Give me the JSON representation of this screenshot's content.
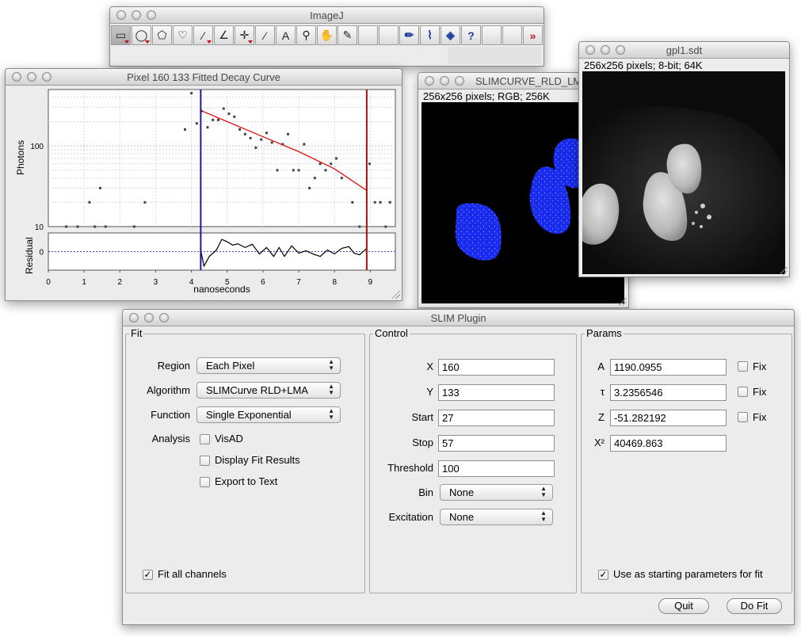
{
  "imagej": {
    "title": "ImageJ",
    "tools": [
      {
        "name": "rectangle-tool-icon",
        "glyph": "▭"
      },
      {
        "name": "oval-tool-icon",
        "glyph": "◯"
      },
      {
        "name": "polygon-tool-icon",
        "glyph": "⬠"
      },
      {
        "name": "freehand-tool-icon",
        "glyph": "♡"
      },
      {
        "name": "line-tool-icon",
        "glyph": "∕"
      },
      {
        "name": "angle-tool-icon",
        "glyph": "∠"
      },
      {
        "name": "point-tool-icon",
        "glyph": "✛"
      },
      {
        "name": "wand-tool-icon",
        "glyph": "⁄"
      },
      {
        "name": "text-tool-icon",
        "glyph": "A"
      },
      {
        "name": "magnifier-tool-icon",
        "glyph": "⚲"
      },
      {
        "name": "scroll-tool-icon",
        "glyph": "✋"
      },
      {
        "name": "color-picker-tool-icon",
        "glyph": "✎"
      },
      {
        "name": "empty-slot",
        "glyph": ""
      },
      {
        "name": "empty-slot",
        "glyph": ""
      },
      {
        "name": "pencil-tool-icon",
        "glyph": "✏"
      },
      {
        "name": "brush-tool-icon",
        "glyph": "⌇"
      },
      {
        "name": "flood-fill-tool-icon",
        "glyph": "◈"
      },
      {
        "name": "help-icon",
        "glyph": "?"
      },
      {
        "name": "empty-slot",
        "glyph": ""
      },
      {
        "name": "empty-slot",
        "glyph": ""
      },
      {
        "name": "more-tools-icon",
        "glyph": "»"
      }
    ]
  },
  "decay_window": {
    "title": "Pixel 160 133 Fitted Decay Curve"
  },
  "chart_data": {
    "type": "scatter",
    "ylabel": "Photons",
    "residual_label": "Residual",
    "xlabel": "nanoseconds",
    "xlim": [
      0,
      9.7
    ],
    "ylim": [
      10,
      500
    ],
    "yscale": "log",
    "x_ticks": [
      "0",
      "1",
      "2",
      "3",
      "4",
      "5",
      "6",
      "7",
      "8",
      "9"
    ],
    "y_ticks": [
      "10",
      "100"
    ],
    "residual_ticks": [
      "0"
    ],
    "start_cursor_ns": 4.26,
    "stop_cursor_ns": 8.9,
    "points": [
      [
        0.5,
        10
      ],
      [
        0.82,
        10
      ],
      [
        1.15,
        20
      ],
      [
        1.3,
        10
      ],
      [
        1.45,
        30
      ],
      [
        1.6,
        10
      ],
      [
        2.4,
        10
      ],
      [
        2.7,
        20
      ],
      [
        3.82,
        160
      ],
      [
        4.0,
        450
      ],
      [
        4.15,
        190
      ],
      [
        4.28,
        270
      ],
      [
        4.45,
        170
      ],
      [
        4.6,
        210
      ],
      [
        4.75,
        210
      ],
      [
        4.9,
        290
      ],
      [
        5.05,
        250
      ],
      [
        5.2,
        230
      ],
      [
        5.35,
        160
      ],
      [
        5.5,
        140
      ],
      [
        5.65,
        125
      ],
      [
        5.8,
        95
      ],
      [
        5.95,
        120
      ],
      [
        6.1,
        145
      ],
      [
        6.25,
        110
      ],
      [
        6.4,
        50
      ],
      [
        6.55,
        105
      ],
      [
        6.7,
        140
      ],
      [
        6.85,
        50
      ],
      [
        7.0,
        50
      ],
      [
        7.15,
        105
      ],
      [
        7.3,
        30
      ],
      [
        7.45,
        40
      ],
      [
        7.6,
        60
      ],
      [
        7.75,
        50
      ],
      [
        7.9,
        60
      ],
      [
        8.05,
        70
      ],
      [
        8.2,
        40
      ],
      [
        8.5,
        20
      ],
      [
        8.7,
        10
      ],
      [
        8.98,
        60
      ],
      [
        9.13,
        20
      ],
      [
        9.28,
        20
      ],
      [
        9.43,
        10
      ],
      [
        9.55,
        20
      ]
    ],
    "fit_curve": [
      [
        4.26,
        275
      ],
      [
        5.0,
        200
      ],
      [
        6.0,
        130
      ],
      [
        7.0,
        85
      ],
      [
        8.0,
        52
      ],
      [
        8.9,
        28
      ]
    ],
    "residual_curve": [
      [
        4.26,
        0.2
      ],
      [
        4.35,
        -1.8
      ],
      [
        4.5,
        -0.6
      ],
      [
        4.7,
        0.2
      ],
      [
        4.85,
        1.5
      ],
      [
        5.0,
        1.2
      ],
      [
        5.15,
        0.8
      ],
      [
        5.3,
        0.95
      ],
      [
        5.5,
        0.5
      ],
      [
        5.7,
        0.9
      ],
      [
        5.9,
        -0.3
      ],
      [
        6.1,
        0.5
      ],
      [
        6.3,
        -0.6
      ],
      [
        6.45,
        0.5
      ],
      [
        6.6,
        -0.6
      ],
      [
        6.8,
        0.7
      ],
      [
        7.0,
        -0.2
      ],
      [
        7.2,
        0.1
      ],
      [
        7.4,
        -0.3
      ],
      [
        7.6,
        -0.6
      ],
      [
        7.8,
        0.2
      ],
      [
        8.0,
        -0.3
      ],
      [
        8.2,
        0.4
      ],
      [
        8.4,
        0.6
      ],
      [
        8.55,
        -0.2
      ],
      [
        8.7,
        -0.4
      ],
      [
        8.9,
        0.4
      ]
    ]
  },
  "slim_window": {
    "title": "SLIMCURVE_RLD_LMA Fitte...",
    "info": "256x256 pixels; RGB; 256K"
  },
  "gpl_window": {
    "title": "gpl1.sdt",
    "info": "256x256 pixels; 8-bit; 64K"
  },
  "plugin": {
    "title": "SLIM Plugin",
    "fit": {
      "title": "Fit",
      "region_label": "Region",
      "region_value": "Each Pixel",
      "algorithm_label": "Algorithm",
      "algorithm_value": "SLIMCurve RLD+LMA",
      "function_label": "Function",
      "function_value": "Single Exponential",
      "analysis_label": "Analysis",
      "visad": "VisAD",
      "visad_checked": false,
      "display_fit": "Display Fit Results",
      "display_fit_checked": false,
      "export": "Export to Text",
      "export_checked": false,
      "fit_all": "Fit all channels",
      "fit_all_checked": true
    },
    "control": {
      "title": "Control",
      "x_label": "X",
      "x_value": "160",
      "y_label": "Y",
      "y_value": "133",
      "start_label": "Start",
      "start_value": "27",
      "stop_label": "Stop",
      "stop_value": "57",
      "threshold_label": "Threshold",
      "threshold_value": "100",
      "bin_label": "Bin",
      "bin_value": "None",
      "excitation_label": "Excitation",
      "excitation_value": "None"
    },
    "params": {
      "title": "Params",
      "a_label": "A",
      "a_value": "1190.0955",
      "tau_label": "τ",
      "tau_value": "3.2356546",
      "z_label": "Z",
      "z_value": "-51.282192",
      "chi_label": "X²",
      "chi_value": "40469.863",
      "fix_label": "Fix",
      "use_starting": "Use as starting parameters for fit",
      "use_starting_checked": true
    },
    "quit_label": "Quit",
    "dofit_label": "Do Fit"
  },
  "colors": {
    "fit_line": "#e01010",
    "start_cursor": "#1a1aa0",
    "stop_cursor": "#a01010",
    "nucleus_fill": "#1a2cf0"
  }
}
